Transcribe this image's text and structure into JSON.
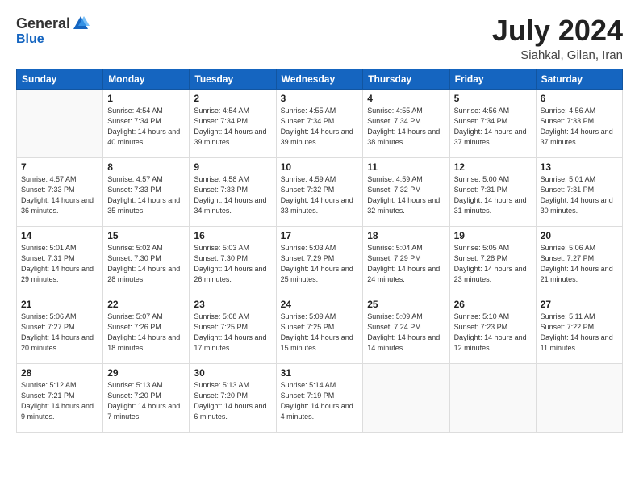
{
  "header": {
    "logo_general": "General",
    "logo_blue": "Blue",
    "title": "July 2024",
    "location": "Siahkal, Gilan, Iran"
  },
  "days_of_week": [
    "Sunday",
    "Monday",
    "Tuesday",
    "Wednesday",
    "Thursday",
    "Friday",
    "Saturday"
  ],
  "weeks": [
    [
      {
        "day": "",
        "empty": true
      },
      {
        "day": "1",
        "sunrise": "4:54 AM",
        "sunset": "7:34 PM",
        "daylight": "14 hours and 40 minutes."
      },
      {
        "day": "2",
        "sunrise": "4:54 AM",
        "sunset": "7:34 PM",
        "daylight": "14 hours and 39 minutes."
      },
      {
        "day": "3",
        "sunrise": "4:55 AM",
        "sunset": "7:34 PM",
        "daylight": "14 hours and 39 minutes."
      },
      {
        "day": "4",
        "sunrise": "4:55 AM",
        "sunset": "7:34 PM",
        "daylight": "14 hours and 38 minutes."
      },
      {
        "day": "5",
        "sunrise": "4:56 AM",
        "sunset": "7:34 PM",
        "daylight": "14 hours and 37 minutes."
      },
      {
        "day": "6",
        "sunrise": "4:56 AM",
        "sunset": "7:33 PM",
        "daylight": "14 hours and 37 minutes."
      }
    ],
    [
      {
        "day": "7",
        "sunrise": "4:57 AM",
        "sunset": "7:33 PM",
        "daylight": "14 hours and 36 minutes."
      },
      {
        "day": "8",
        "sunrise": "4:57 AM",
        "sunset": "7:33 PM",
        "daylight": "14 hours and 35 minutes."
      },
      {
        "day": "9",
        "sunrise": "4:58 AM",
        "sunset": "7:33 PM",
        "daylight": "14 hours and 34 minutes."
      },
      {
        "day": "10",
        "sunrise": "4:59 AM",
        "sunset": "7:32 PM",
        "daylight": "14 hours and 33 minutes."
      },
      {
        "day": "11",
        "sunrise": "4:59 AM",
        "sunset": "7:32 PM",
        "daylight": "14 hours and 32 minutes."
      },
      {
        "day": "12",
        "sunrise": "5:00 AM",
        "sunset": "7:31 PM",
        "daylight": "14 hours and 31 minutes."
      },
      {
        "day": "13",
        "sunrise": "5:01 AM",
        "sunset": "7:31 PM",
        "daylight": "14 hours and 30 minutes."
      }
    ],
    [
      {
        "day": "14",
        "sunrise": "5:01 AM",
        "sunset": "7:31 PM",
        "daylight": "14 hours and 29 minutes."
      },
      {
        "day": "15",
        "sunrise": "5:02 AM",
        "sunset": "7:30 PM",
        "daylight": "14 hours and 28 minutes."
      },
      {
        "day": "16",
        "sunrise": "5:03 AM",
        "sunset": "7:30 PM",
        "daylight": "14 hours and 26 minutes."
      },
      {
        "day": "17",
        "sunrise": "5:03 AM",
        "sunset": "7:29 PM",
        "daylight": "14 hours and 25 minutes."
      },
      {
        "day": "18",
        "sunrise": "5:04 AM",
        "sunset": "7:29 PM",
        "daylight": "14 hours and 24 minutes."
      },
      {
        "day": "19",
        "sunrise": "5:05 AM",
        "sunset": "7:28 PM",
        "daylight": "14 hours and 23 minutes."
      },
      {
        "day": "20",
        "sunrise": "5:06 AM",
        "sunset": "7:27 PM",
        "daylight": "14 hours and 21 minutes."
      }
    ],
    [
      {
        "day": "21",
        "sunrise": "5:06 AM",
        "sunset": "7:27 PM",
        "daylight": "14 hours and 20 minutes."
      },
      {
        "day": "22",
        "sunrise": "5:07 AM",
        "sunset": "7:26 PM",
        "daylight": "14 hours and 18 minutes."
      },
      {
        "day": "23",
        "sunrise": "5:08 AM",
        "sunset": "7:25 PM",
        "daylight": "14 hours and 17 minutes."
      },
      {
        "day": "24",
        "sunrise": "5:09 AM",
        "sunset": "7:25 PM",
        "daylight": "14 hours and 15 minutes."
      },
      {
        "day": "25",
        "sunrise": "5:09 AM",
        "sunset": "7:24 PM",
        "daylight": "14 hours and 14 minutes."
      },
      {
        "day": "26",
        "sunrise": "5:10 AM",
        "sunset": "7:23 PM",
        "daylight": "14 hours and 12 minutes."
      },
      {
        "day": "27",
        "sunrise": "5:11 AM",
        "sunset": "7:22 PM",
        "daylight": "14 hours and 11 minutes."
      }
    ],
    [
      {
        "day": "28",
        "sunrise": "5:12 AM",
        "sunset": "7:21 PM",
        "daylight": "14 hours and 9 minutes."
      },
      {
        "day": "29",
        "sunrise": "5:13 AM",
        "sunset": "7:20 PM",
        "daylight": "14 hours and 7 minutes."
      },
      {
        "day": "30",
        "sunrise": "5:13 AM",
        "sunset": "7:20 PM",
        "daylight": "14 hours and 6 minutes."
      },
      {
        "day": "31",
        "sunrise": "5:14 AM",
        "sunset": "7:19 PM",
        "daylight": "14 hours and 4 minutes."
      },
      {
        "day": "",
        "empty": true
      },
      {
        "day": "",
        "empty": true
      },
      {
        "day": "",
        "empty": true
      }
    ]
  ]
}
